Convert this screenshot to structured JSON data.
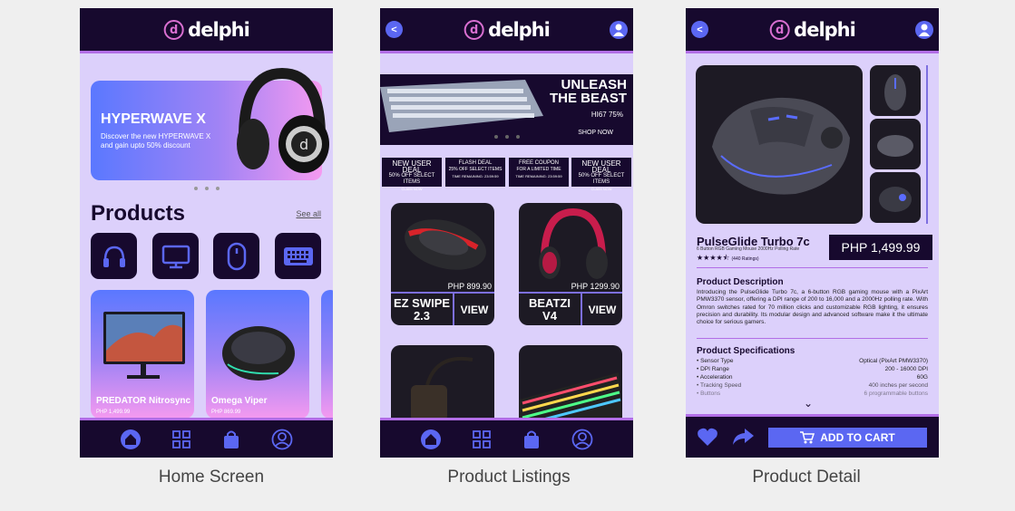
{
  "screens": {
    "home": {
      "logo_text": "delphi",
      "hero": {
        "title": "HYPERWAVE X",
        "subtitle": "Discover the new HYPERWAVE X and gain upto 50% discount"
      },
      "section_title": "Products",
      "see_all": "See all",
      "categories": [
        "headphones-icon",
        "monitor-icon",
        "mouse-icon",
        "keyboard-icon"
      ],
      "products": [
        {
          "name": "PREDATOR Nitrosync",
          "price": "PHP 1,499.99"
        },
        {
          "name": "Omega Viper",
          "price": "PHP 869.99"
        }
      ],
      "caption": "Home Screen"
    },
    "listings": {
      "logo_text": "delphi",
      "banner": {
        "title_line1": "UNLEASH",
        "title_line2": "THE BEAST",
        "model": "HI67 75%",
        "shop": "SHOP NOW"
      },
      "deals": [
        {
          "title": "NEW USER DEAL",
          "sub": "50% OFF SELECT ITEMS",
          "foot": "CLAIM NOW"
        },
        {
          "title": "FLASH DEAL",
          "sub": "25% OFF SELECT ITEMS",
          "foot": "TIME REMAINING: 23:59:59"
        },
        {
          "title": "FREE COUPON",
          "sub": "FOR A LIMITED TIME",
          "foot": "TIME REMAINING: 23:59:59"
        },
        {
          "title": "NEW USER DEAL",
          "sub": "50% OFF SELECT ITEMS",
          "foot": "CLAIM NOW"
        }
      ],
      "items": [
        {
          "name_line1": "EZ SWIPE",
          "name_line2": "2.3",
          "price": "PHP 899.90",
          "view": "VIEW"
        },
        {
          "name_line1": "BEATZI",
          "name_line2": "V4",
          "price": "PHP 1299.90",
          "view": "VIEW"
        }
      ],
      "caption": "Product Listings"
    },
    "detail": {
      "logo_text": "delphi",
      "name": "PulseGlide Turbo 7c",
      "subtitle": "6 Button RGB Gaming Mouse 2000Hz Polling Rate",
      "stars": "★★★★⯪",
      "ratings": "(440 Ratings)",
      "price": "PHP 1,499.99",
      "desc_title": "Product Description",
      "description": "Introducing the PulseGlide Turbo 7c, a 6-button RGB gaming mouse with a PixArt PMW3370 sensor, offering a DPI range of 200 to 16,000 and a 2000Hz polling rate. With Omron switches rated for 70 million clicks and customizable RGB lighting, it ensures precision and durability. Its modular design and advanced software make it the ultimate choice for serious gamers.",
      "spec_title": "Product Specifications",
      "specs": [
        {
          "label": "• Sensor Type",
          "value": "Optical (PixArt PMW3370)"
        },
        {
          "label": "• DPI Range",
          "value": "200 - 16000 DPI"
        },
        {
          "label": "• Acceleration",
          "value": "60G"
        },
        {
          "label": "• Tracking Speed",
          "value": "400 inches per second"
        },
        {
          "label": "• Buttons",
          "value": "6 programmable buttons"
        }
      ],
      "add_to_cart": "ADD TO CART",
      "caption": "Product Detail"
    }
  },
  "colors": {
    "dark": "#17092e",
    "accent": "#5b67f2",
    "bg": "#dcd0fb",
    "pink": "#d96fd1"
  }
}
